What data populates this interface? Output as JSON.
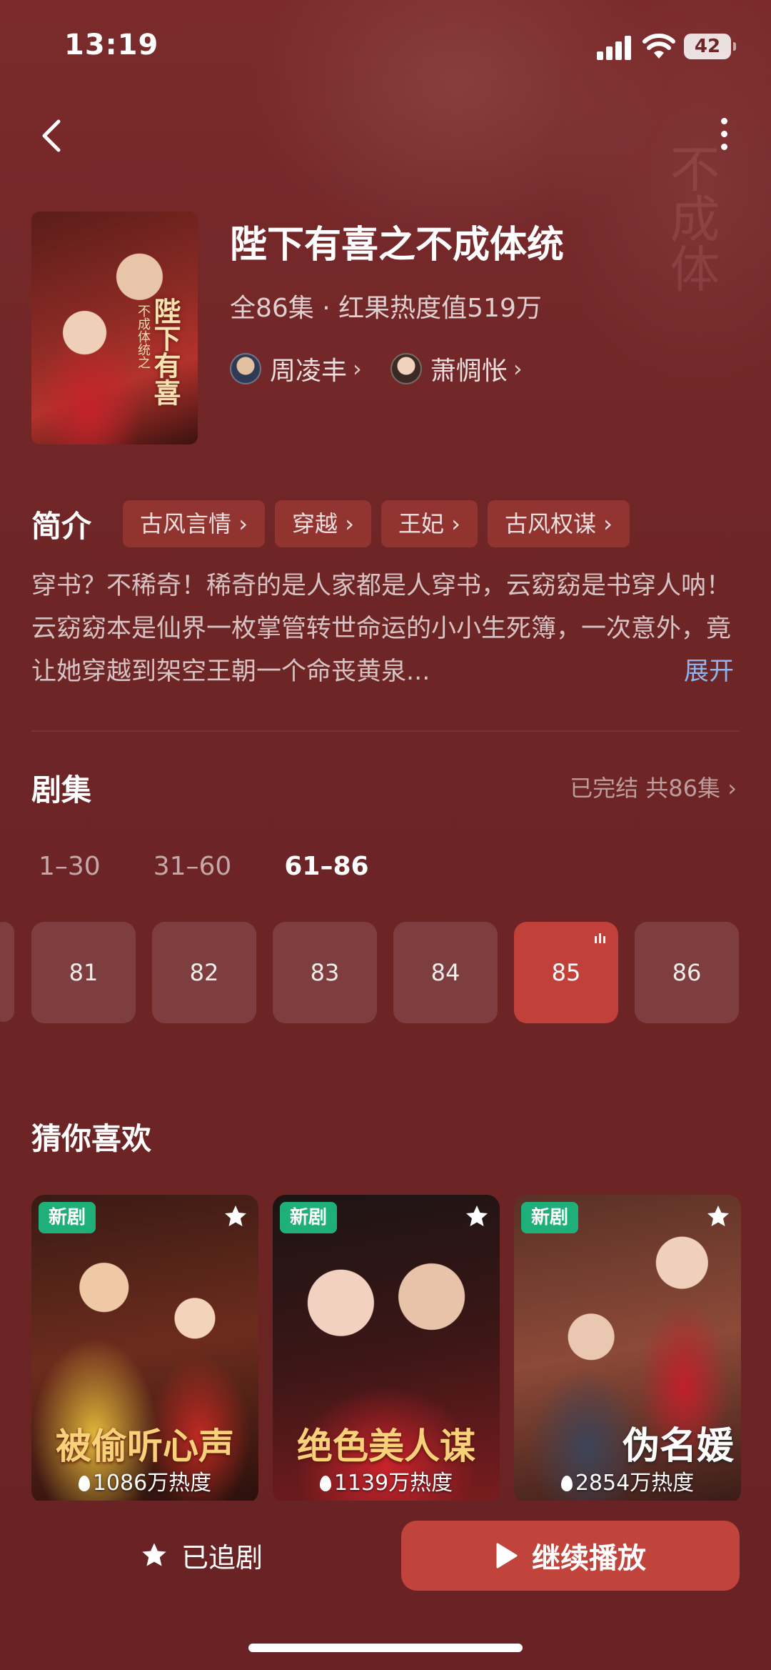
{
  "status_bar": {
    "time": "13:19",
    "battery": "42"
  },
  "drama": {
    "title": "陛下有喜之不成体统",
    "meta": "全86集 · 红果热度值519万",
    "cover_title": "陛下有喜",
    "cover_sub": "不成体统之",
    "cast": [
      {
        "name": "周凌丰"
      },
      {
        "name": "萧惆怅"
      }
    ]
  },
  "intro": {
    "heading": "简介",
    "tags": [
      "古风言情",
      "穿越",
      "王妃",
      "古风权谋"
    ],
    "synopsis": "穿书？不稀奇！稀奇的是人家都是人穿书，云窈窈是书穿人呐！云窈窈本是仙界一枚掌管转世命运的小小生死簿，一次意外，竟让她穿越到架空王朝一个命丧黄泉...",
    "expand_label": "展开"
  },
  "episodes": {
    "heading": "剧集",
    "status": "已完结 共86集",
    "ranges": [
      "1–30",
      "31–60",
      "61–86"
    ],
    "active_range": 2,
    "items": [
      "81",
      "82",
      "83",
      "84",
      "85",
      "86"
    ],
    "playing": "85"
  },
  "recommend": {
    "heading": "猜你喜欢",
    "cards": [
      {
        "badge": "新剧",
        "poster_text": "被偷听心声",
        "heat": "1086万热度"
      },
      {
        "badge": "新剧",
        "poster_text": "绝色美人谋",
        "heat": "1139万热度"
      },
      {
        "badge": "新剧",
        "poster_text": "伪名媛",
        "heat": "2854万热度"
      }
    ]
  },
  "bottom": {
    "follow_label": "已追剧",
    "play_label": "继续播放"
  },
  "colors": {
    "background": "#6e2526",
    "accent": "#c0443c",
    "link": "#8fb3ea",
    "badge": "#1fb07a"
  }
}
